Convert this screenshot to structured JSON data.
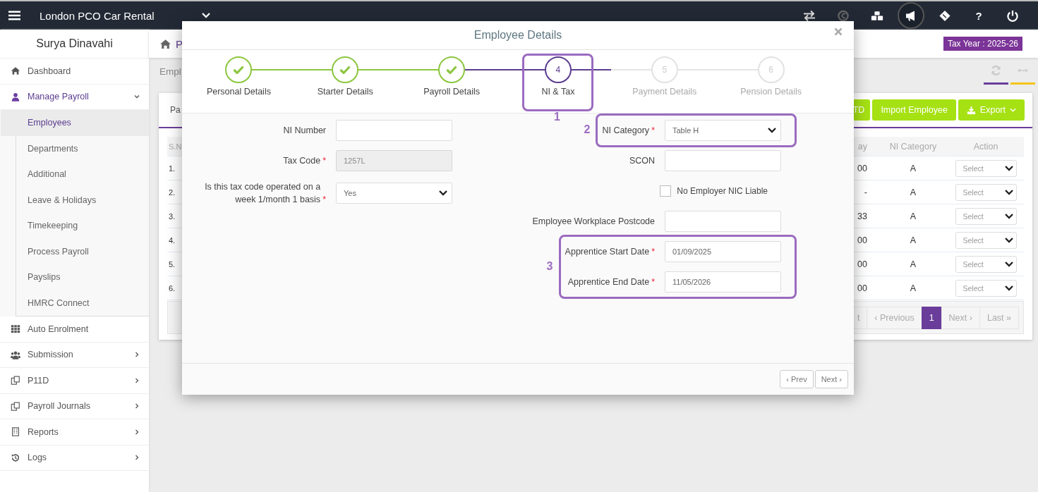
{
  "topbar": {
    "company": "London PCO Car Rental",
    "help": "?"
  },
  "sidebar": {
    "user": "Surya Dinavahi",
    "items": [
      {
        "label": "Dashboard",
        "selected": false
      },
      {
        "label": "Manage Payroll",
        "selected": true,
        "expanded": true,
        "children": [
          {
            "label": "Employees",
            "selected": true
          },
          {
            "label": "Departments",
            "selected": false
          },
          {
            "label": "Additional",
            "selected": false
          },
          {
            "label": "Leave & Holidays",
            "selected": false
          },
          {
            "label": "Timekeeping",
            "selected": false
          },
          {
            "label": "Process Payroll",
            "selected": false
          },
          {
            "label": "Payslips",
            "selected": false
          },
          {
            "label": "HMRC Connect",
            "selected": false
          }
        ]
      },
      {
        "label": "Auto Enrolment",
        "selected": false
      },
      {
        "label": "Submission",
        "selected": false,
        "expanded": false
      },
      {
        "label": "P11D",
        "selected": false,
        "expanded": false
      },
      {
        "label": "Payroll Journals",
        "selected": false,
        "expanded": false
      },
      {
        "label": "Reports",
        "selected": false,
        "expanded": false
      },
      {
        "label": "Logs",
        "selected": false,
        "expanded": false
      }
    ]
  },
  "background": {
    "breadcrumb": "P",
    "page_title": "Empl",
    "tax_year": "Tax Year : 2025-26",
    "tab": "Pa",
    "buttons": [
      {
        "label": "TD",
        "kind": "plain"
      },
      {
        "label": "Import Employee",
        "kind": "plain"
      },
      {
        "label": "Export",
        "kind": "dropdown"
      }
    ],
    "table": {
      "columns": [
        "S.N",
        "ay",
        "NI Category",
        "Action"
      ],
      "rows": [
        {
          "sn": "1.",
          "pay": "00",
          "ni": "A",
          "action": "Select"
        },
        {
          "sn": "2.",
          "pay": "-",
          "ni": "A",
          "action": "Select"
        },
        {
          "sn": "3.",
          "pay": "33",
          "ni": "A",
          "action": "Select"
        },
        {
          "sn": "4.",
          "pay": "00",
          "ni": "A",
          "action": "Select"
        },
        {
          "sn": "5.",
          "pay": "00",
          "ni": "A",
          "action": "Select"
        },
        {
          "sn": "6.",
          "pay": "00",
          "ni": "A",
          "action": "Select"
        }
      ]
    },
    "pagination": [
      {
        "label": "t",
        "selected": false
      },
      {
        "label": "‹ Previous",
        "selected": false
      },
      {
        "label": "1",
        "selected": true
      },
      {
        "label": "Next ›",
        "selected": false
      },
      {
        "label": "Last »",
        "selected": false
      }
    ]
  },
  "modal": {
    "title": "Employee Details",
    "steps": [
      {
        "label": "Personal Details",
        "completed": true,
        "selected": false
      },
      {
        "label": "Starter Details",
        "completed": true,
        "selected": false
      },
      {
        "label": "Payroll Details",
        "completed": true,
        "selected": false
      },
      {
        "label": "NI & Tax",
        "number": "4",
        "completed": false,
        "selected": true,
        "annotation": "1"
      },
      {
        "label": "Payment Details",
        "number": "5",
        "completed": false,
        "selected": false
      },
      {
        "label": "Pension Details",
        "number": "6",
        "completed": false,
        "selected": false
      }
    ],
    "left_fields": [
      {
        "kind": "text",
        "label": "NI Number",
        "disabled": false
      },
      {
        "kind": "text",
        "label": "Tax Code",
        "required_mark": "*",
        "disabled": true,
        "value": "1257L"
      },
      {
        "kind": "select",
        "label": "Is this tax code operated on a week 1/month 1 basis",
        "required_mark": "*",
        "value": "Yes"
      }
    ],
    "right_groups": [
      {
        "annotation": "2",
        "fields": [
          {
            "kind": "select",
            "label": "NI Category",
            "required_mark": "*",
            "value": "Table H"
          }
        ]
      },
      {
        "fields": [
          {
            "kind": "text",
            "label": "SCON"
          },
          {
            "kind": "checkbox",
            "label": "No Employer NIC Liable",
            "checked": false
          },
          {
            "kind": "text",
            "label": "Employee Workplace Postcode"
          }
        ]
      },
      {
        "annotation": "3",
        "fields": [
          {
            "kind": "text",
            "label": "Apprentice Start Date",
            "required_mark": "*",
            "value": "01/09/2025"
          },
          {
            "kind": "text",
            "label": "Apprentice End Date",
            "required_mark": "*",
            "value": "11/05/2026"
          }
        ]
      }
    ],
    "footer_buttons": [
      "‹ Prev",
      "Next ›"
    ]
  }
}
